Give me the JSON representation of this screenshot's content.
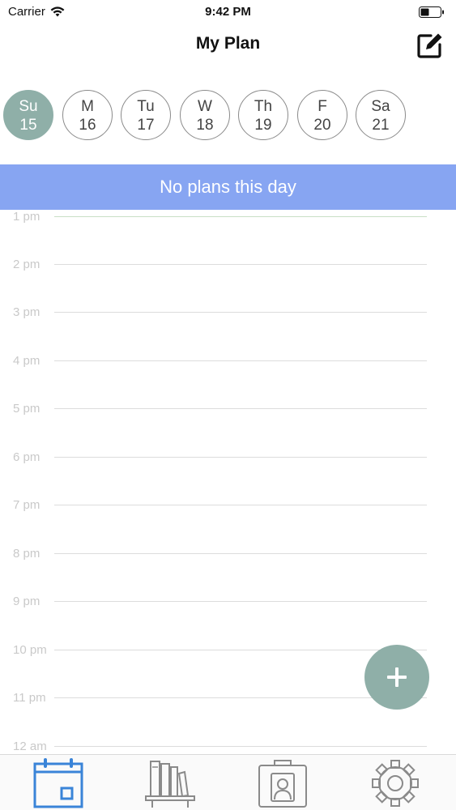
{
  "status": {
    "carrier": "Carrier",
    "time": "9:42 PM"
  },
  "nav": {
    "title": "My Plan"
  },
  "week": [
    {
      "day": "Su",
      "date": "15",
      "selected": true
    },
    {
      "day": "M",
      "date": "16",
      "selected": false
    },
    {
      "day": "Tu",
      "date": "17",
      "selected": false
    },
    {
      "day": "W",
      "date": "18",
      "selected": false
    },
    {
      "day": "Th",
      "date": "19",
      "selected": false
    },
    {
      "day": "F",
      "date": "20",
      "selected": false
    },
    {
      "day": "Sa",
      "date": "21",
      "selected": false
    }
  ],
  "banner": {
    "text": "No plans this day"
  },
  "timeline": {
    "hours": [
      "1 pm",
      "2 pm",
      "3 pm",
      "4 pm",
      "5 pm",
      "6 pm",
      "7 pm",
      "8 pm",
      "9 pm",
      "10 pm",
      "11 pm",
      "12 am"
    ]
  },
  "colors": {
    "accent": "#8fafa8",
    "banner": "#87a5f2",
    "tab_active": "#3a84d8",
    "tab_inactive": "#8a8a8a"
  },
  "tabs": [
    {
      "name": "calendar-tab",
      "icon": "calendar-icon",
      "active": true
    },
    {
      "name": "library-tab",
      "icon": "bookshelf-icon",
      "active": false
    },
    {
      "name": "profile-tab",
      "icon": "contact-card-icon",
      "active": false
    },
    {
      "name": "settings-tab",
      "icon": "gear-icon",
      "active": false
    }
  ]
}
